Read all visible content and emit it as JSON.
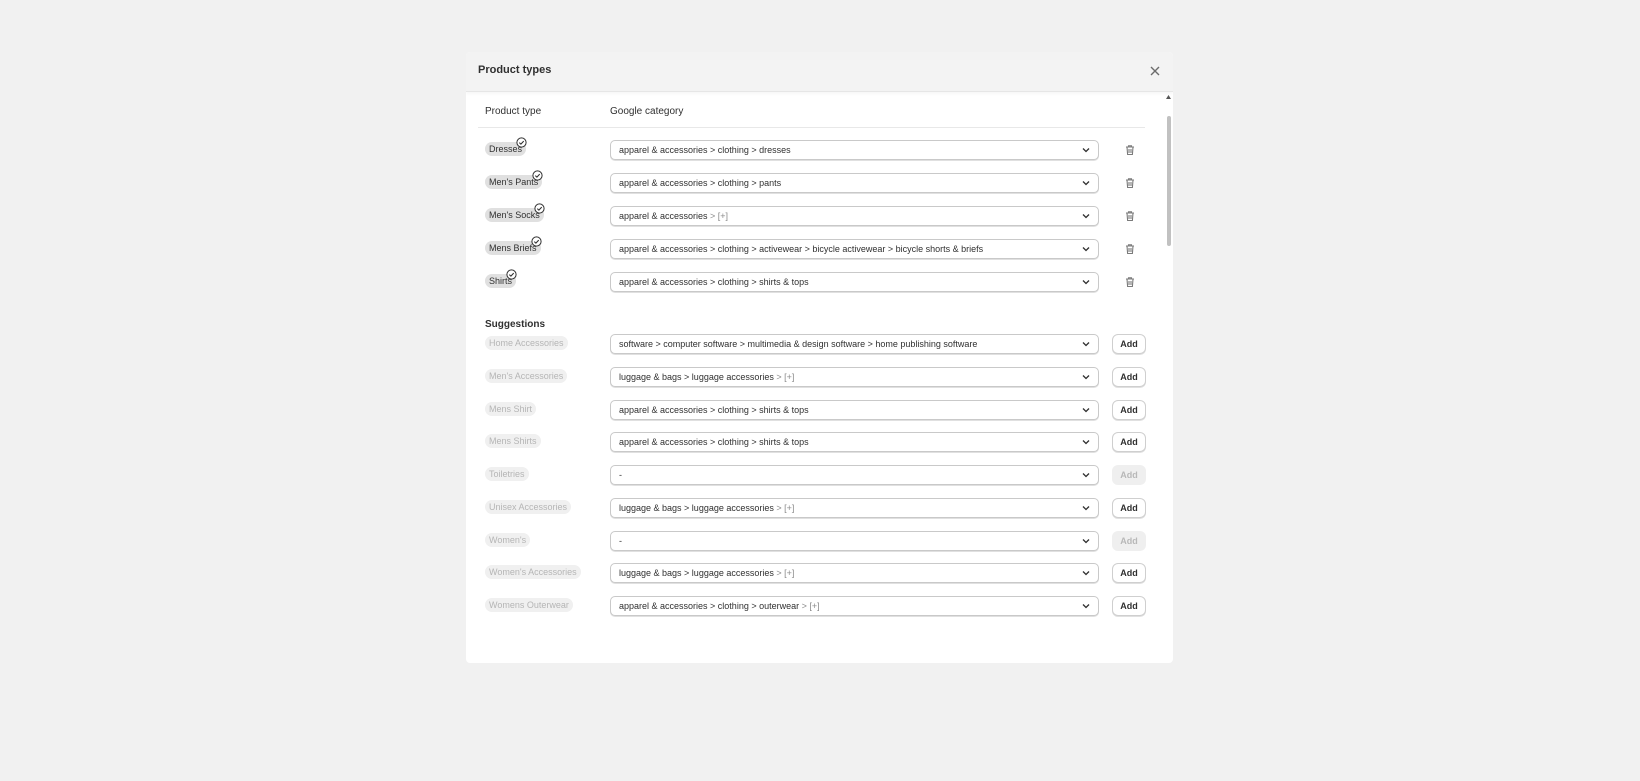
{
  "dialog": {
    "title": "Product types",
    "close_icon": "close-icon"
  },
  "columns": {
    "product_type": "Product type",
    "google_category": "Google category"
  },
  "types": [
    {
      "name": "Dresses",
      "category": "apparel & accessories > clothing > dresses",
      "more": ""
    },
    {
      "name": "Men's Pants",
      "category": "apparel & accessories > clothing > pants",
      "more": ""
    },
    {
      "name": "Men's Socks",
      "category": "apparel & accessories",
      "more": " > [+]"
    },
    {
      "name": "Mens Briefs",
      "category": "apparel & accessories > clothing > activewear > bicycle activewear > bicycle shorts & briefs",
      "more": ""
    },
    {
      "name": "Shirts",
      "category": "apparel & accessories > clothing > shirts & tops",
      "more": ""
    }
  ],
  "suggestions_title": "Suggestions",
  "suggestions": [
    {
      "name": "Home Accessories",
      "category": "software > computer software > multimedia & design software > home publishing software",
      "more": "",
      "add": "Add",
      "enabled": true
    },
    {
      "name": "Men's Accessories",
      "category": "luggage & bags > luggage accessories",
      "more": " > [+]",
      "add": "Add",
      "enabled": true
    },
    {
      "name": "Mens Shirt",
      "category": "apparel & accessories > clothing > shirts & tops",
      "more": "",
      "add": "Add",
      "enabled": true
    },
    {
      "name": "Mens Shirts",
      "category": "apparel & accessories > clothing > shirts & tops",
      "more": "",
      "add": "Add",
      "enabled": true
    },
    {
      "name": "Toiletries",
      "category": "-",
      "more": "",
      "add": "Add",
      "enabled": false
    },
    {
      "name": "Unisex Accessories",
      "category": "luggage & bags > luggage accessories",
      "more": " > [+]",
      "add": "Add",
      "enabled": true
    },
    {
      "name": "Women's",
      "category": "-",
      "more": "",
      "add": "Add",
      "enabled": false
    },
    {
      "name": "Women's Accessories",
      "category": "luggage & bags > luggage accessories",
      "more": " > [+]",
      "add": "Add",
      "enabled": true
    },
    {
      "name": "Womens Outerwear",
      "category": "apparel & accessories > clothing > outerwear",
      "more": " > [+]",
      "add": "Add",
      "enabled": true
    }
  ]
}
